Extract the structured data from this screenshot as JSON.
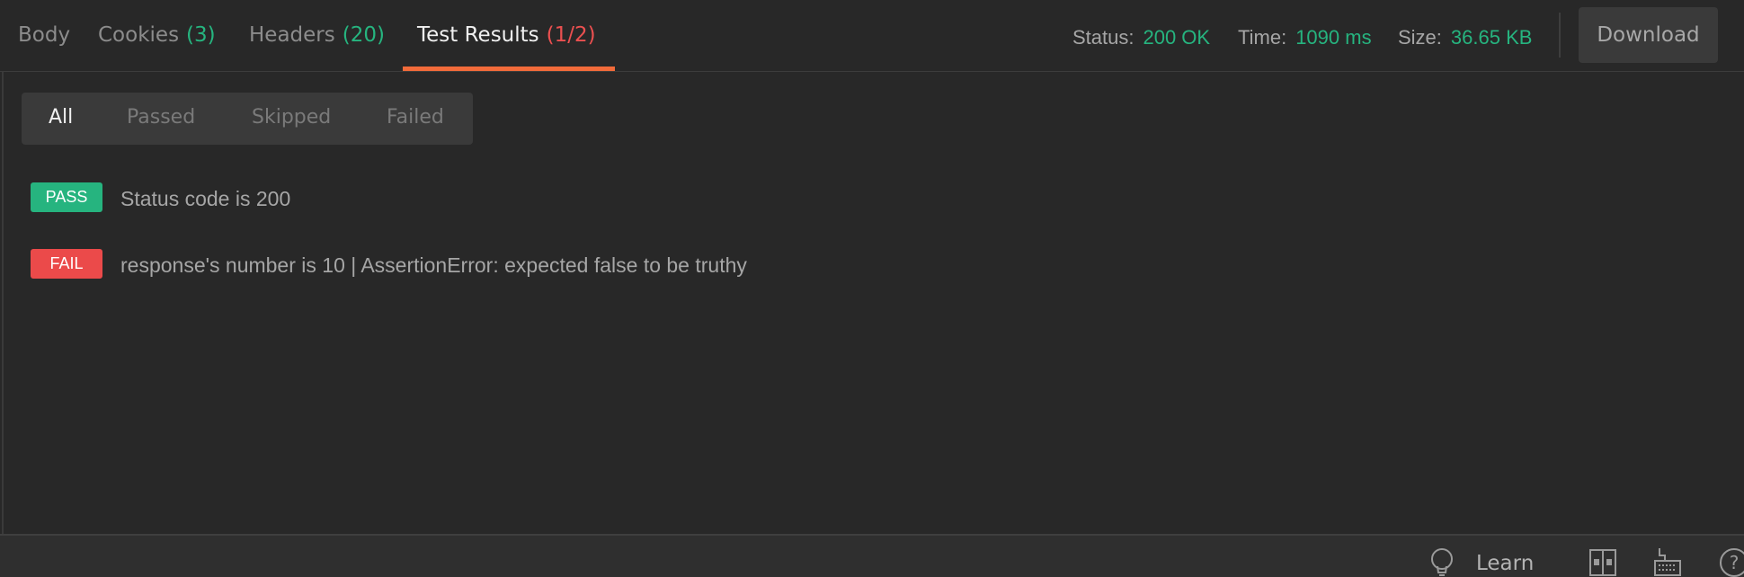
{
  "tabs": [
    {
      "label": "Body",
      "count": ""
    },
    {
      "label": "Cookies",
      "count": "(3)"
    },
    {
      "label": "Headers",
      "count": "(20)"
    },
    {
      "label": "Test Results",
      "count": "(1/2)"
    }
  ],
  "active_tab": "Test Results",
  "response": {
    "status_label": "Status:",
    "status_value": "200 OK",
    "time_label": "Time:",
    "time_value": "1090 ms",
    "size_label": "Size:",
    "size_value": "36.65 KB"
  },
  "download_label": "Download",
  "filters": [
    "All",
    "Passed",
    "Skipped",
    "Failed"
  ],
  "active_filter": "All",
  "results": [
    {
      "status": "PASS",
      "text": "Status code is 200"
    },
    {
      "status": "FAIL",
      "text": "response's number is 10 | AssertionError: expected false to be truthy"
    }
  ],
  "statusbar": {
    "learn_label": "Learn",
    "icons": [
      "lightbulb-icon",
      "two-pane-icon",
      "keyboard-icon",
      "help-icon"
    ]
  },
  "colors": {
    "background": "#282828",
    "accent_orange": "#f26b3a",
    "pass_green": "#26b47f",
    "fail_red": "#eb4a4a"
  }
}
